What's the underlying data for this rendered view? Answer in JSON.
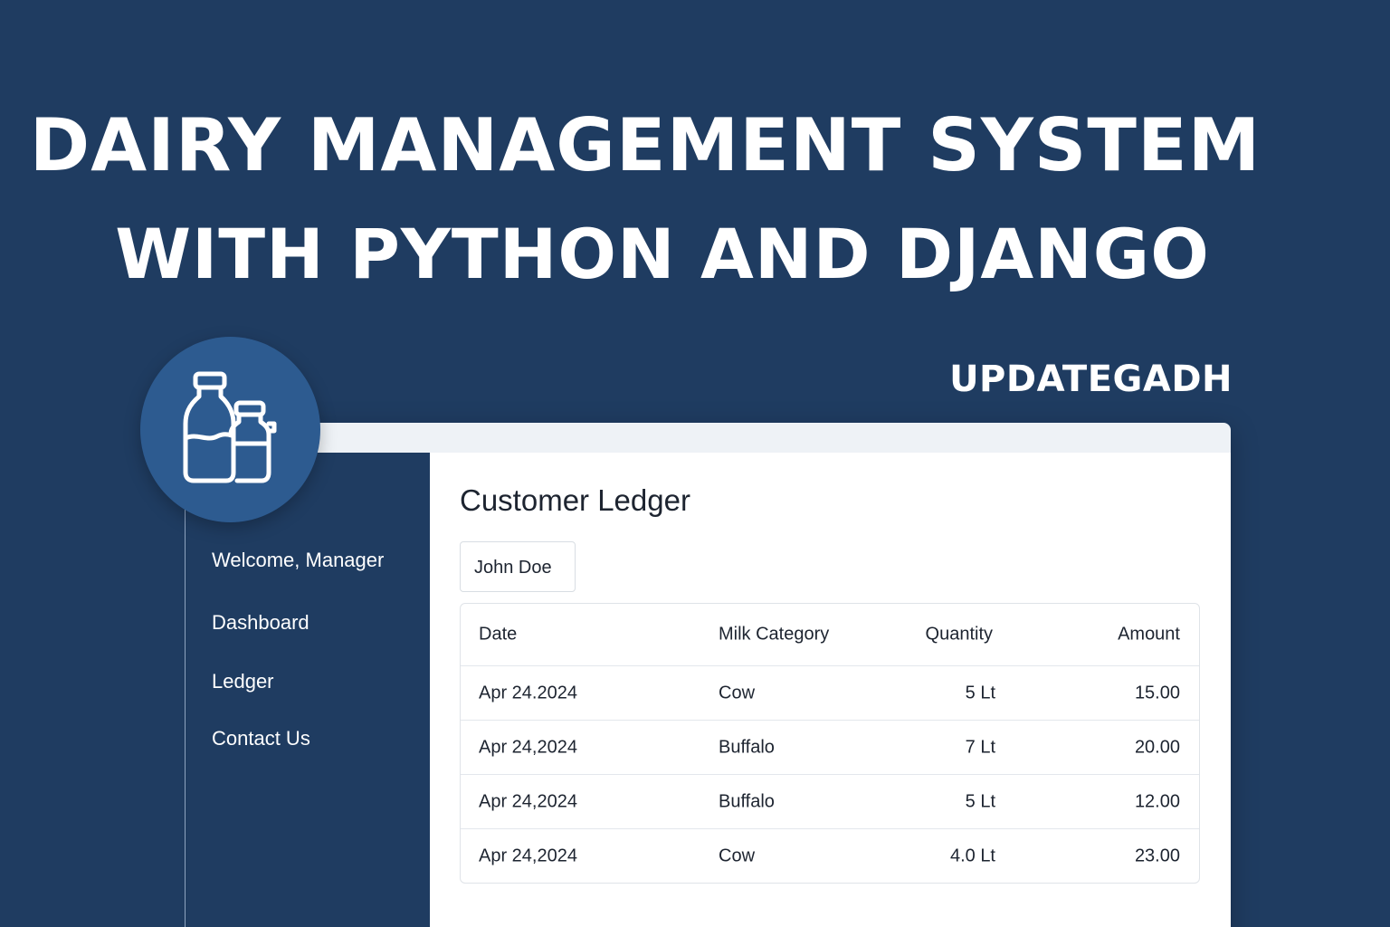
{
  "headline": {
    "line1": "DAIRY MANAGEMENT SYSTEM",
    "line2": "WITH PYTHON AND DJANGO"
  },
  "brand": "UPDATEGADH",
  "logo": {
    "icon": "milk-bottles-icon"
  },
  "sidebar": {
    "welcome": "Welcome, Manager",
    "items": [
      {
        "label": "Dashboard"
      },
      {
        "label": "Ledger"
      },
      {
        "label": "Contact Us"
      }
    ]
  },
  "main": {
    "title": "Customer Ledger",
    "customer_select": "John Doe",
    "table": {
      "headers": [
        "Date",
        "Milk Category",
        "Quantity",
        "Amount"
      ],
      "rows": [
        [
          "Apr 24.2024",
          "Cow",
          "5 Lt",
          "15.00"
        ],
        [
          "Apr 24,2024",
          "Buffalo",
          "7 Lt",
          "20.00"
        ],
        [
          "Apr 24,2024",
          "Buffalo",
          "5 Lt",
          "12.00"
        ],
        [
          "Apr 24,2024",
          "Cow",
          "4.0 Lt",
          "23.00"
        ]
      ]
    }
  },
  "colors": {
    "background": "#1f3c61",
    "logo_circle": "#2d5b90",
    "panel": "#ffffff"
  }
}
